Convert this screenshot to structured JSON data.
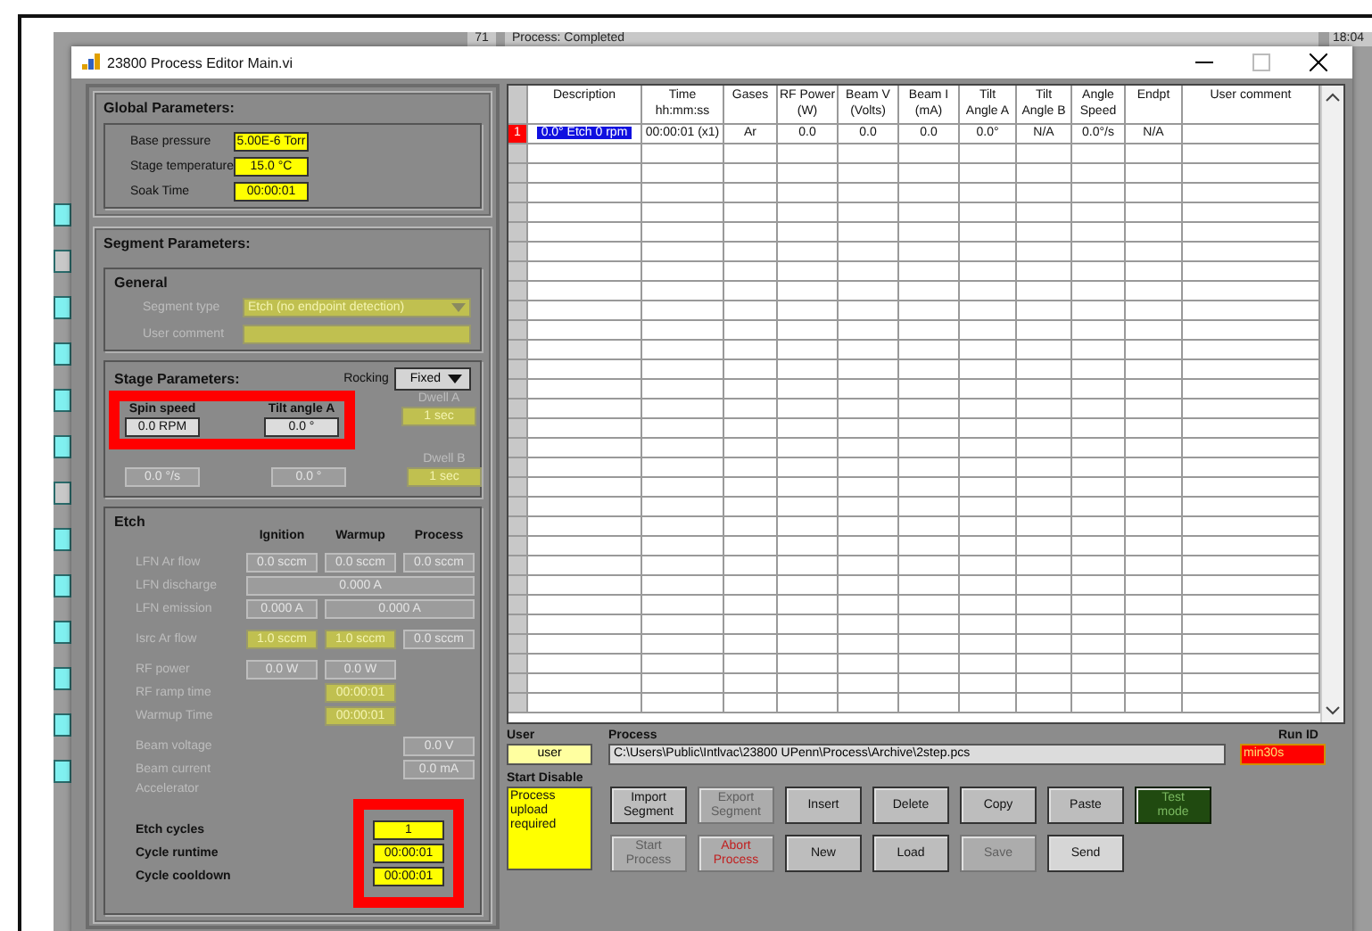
{
  "background_app": {
    "counter": "71",
    "status": "Process: Completed",
    "clock": "18:04"
  },
  "window": {
    "title": "23800 Process Editor Main.vi"
  },
  "global_parameters": {
    "title": "Global Parameters:",
    "fields": [
      {
        "label": "Base pressure",
        "value": "5.00E-6 Torr",
        "disabled": false,
        "highlighted": true
      },
      {
        "label": "Stage temperature",
        "value": "15.0 °C",
        "disabled": false,
        "highlighted": true
      },
      {
        "label": "Soak Time",
        "value": "00:00:01",
        "disabled": false,
        "highlighted": true
      }
    ]
  },
  "segment_parameters": {
    "title": "Segment Parameters:",
    "general": {
      "title": "General",
      "fields": [
        {
          "label": "Segment type",
          "kind": "dropdown",
          "value": "Etch (no endpoint detection)",
          "disabled": true,
          "highlighted": true
        },
        {
          "label": "User comment",
          "kind": "text",
          "disabled": true,
          "highlighted": true
        }
      ]
    },
    "stage": {
      "title": "Stage Parameters:",
      "rocking": {
        "label": "Rocking",
        "value": "Fixed"
      },
      "fields": [
        {
          "label": "Spin speed",
          "value": "0.0 RPM",
          "disabled": false,
          "highlighted": false
        },
        {
          "label": "Tilt angle A",
          "value": "0.0 °",
          "disabled": false,
          "highlighted": false
        },
        {
          "label": "Dwell A",
          "value": "1 sec",
          "disabled": true,
          "highlighted": true
        },
        {
          "value": "0.0 °/s",
          "disabled": true,
          "highlighted": false
        },
        {
          "value": "0.0 °",
          "disabled": true,
          "highlighted": false
        },
        {
          "label": "Dwell B",
          "value": "1 sec",
          "disabled": true,
          "highlighted": true
        }
      ]
    },
    "etch": {
      "title": "Etch",
      "columns": [
        "Ignition",
        "Warmup",
        "Process"
      ],
      "groups": [
        [
          {
            "label": "LFN Ar flow",
            "disabled": true,
            "cells": [
              {
                "kind": "single",
                "value": "0.0 sccm",
                "disabled": true,
                "highlighted": false
              },
              {
                "kind": "single",
                "value": "0.0 sccm",
                "disabled": true,
                "highlighted": false
              },
              {
                "kind": "single",
                "value": "0.0 sccm",
                "disabled": true,
                "highlighted": false
              }
            ]
          },
          {
            "label": "LFN discharge",
            "disabled": true,
            "cells": [
              {
                "kind": "wide",
                "value": "0.000 A",
                "disabled": true,
                "highlighted": false
              }
            ]
          },
          {
            "label": "LFN emission",
            "disabled": true,
            "cells": [
              {
                "kind": "single",
                "value": "0.000 A",
                "disabled": true,
                "highlighted": false
              },
              {
                "kind": "wide",
                "value": "0.000 A",
                "disabled": true,
                "highlighted": false
              }
            ]
          }
        ],
        [
          {
            "label": "Isrc Ar flow",
            "disabled": true,
            "cells": [
              {
                "kind": "single",
                "value": "1.0 sccm",
                "disabled": true,
                "highlighted": true
              },
              {
                "kind": "single",
                "value": "1.0 sccm",
                "disabled": true,
                "highlighted": true
              },
              {
                "kind": "single",
                "value": "0.0 sccm",
                "disabled": true,
                "highlighted": false
              }
            ]
          }
        ],
        [
          {
            "label": "RF power",
            "disabled": true,
            "cells": [
              {
                "kind": "single",
                "value": "0.0 W",
                "disabled": true,
                "highlighted": false
              },
              {
                "kind": "single",
                "value": "0.0 W",
                "disabled": true,
                "highlighted": false
              }
            ]
          },
          {
            "label": "RF ramp time",
            "disabled": true,
            "cells": [
              null,
              {
                "kind": "single",
                "value": "00:00:01",
                "disabled": true,
                "highlighted": true
              }
            ]
          },
          {
            "label": "Warmup Time",
            "disabled": true,
            "cells": [
              null,
              {
                "kind": "single",
                "value": "00:00:01",
                "disabled": true,
                "highlighted": true
              }
            ]
          }
        ],
        [
          {
            "label": "Beam voltage",
            "disabled": true,
            "cells": [
              null,
              null,
              {
                "kind": "single",
                "value": "0.0 V",
                "disabled": true,
                "highlighted": false
              }
            ]
          },
          {
            "label": "Beam current",
            "disabled": true,
            "cells": [
              null,
              null,
              {
                "kind": "single",
                "value": "0.0 mA",
                "disabled": true,
                "highlighted": false
              }
            ]
          },
          {
            "label": "Accelerator",
            "disabled": true
          }
        ]
      ],
      "cycles": [
        {
          "label": "Etch cycles",
          "value": "1",
          "disabled": false,
          "highlighted": true
        },
        {
          "label": "Cycle runtime",
          "value": "00:00:01",
          "disabled": false,
          "highlighted": true
        },
        {
          "label": "Cycle cooldown",
          "value": "00:00:01",
          "disabled": false,
          "highlighted": true
        }
      ]
    }
  },
  "table": {
    "columns": [
      "Description",
      "Time\nhh:mm:ss",
      "Gases",
      "RF Power\n(W)",
      "Beam V\n(Volts)",
      "Beam I\n(mA)",
      "Tilt\nAngle A",
      "Tilt\nAngle B",
      "Angle\nSpeed",
      "Endpt",
      "User comment"
    ],
    "rows": [
      {
        "number": "1",
        "selected": true,
        "cells": [
          "0.0° Etch 0 rpm",
          "00:00:01 (x1)",
          "Ar",
          "0.0",
          "0.0",
          "0.0",
          "0.0°",
          "N/A",
          "0.0°/s",
          "N/A"
        ]
      }
    ]
  },
  "user": {
    "label": "User",
    "value": "user"
  },
  "process": {
    "label": "Process",
    "path": "C:\\Users\\Public\\Intlvac\\23800 UPenn\\Process\\Archive\\2step.pcs"
  },
  "run_id": {
    "label": "Run ID",
    "value": "min30s"
  },
  "start_disable": {
    "label": "Start Disable",
    "message": "Process\nupload\nrequired"
  },
  "buttons": [
    [
      {
        "label": "Import\nSegment",
        "kind": "normal",
        "disabled": false,
        "focused": false
      },
      {
        "label": "Export\nSegment",
        "kind": "normal",
        "disabled": true,
        "focused": false
      },
      {
        "label": "Insert",
        "kind": "normal",
        "disabled": false,
        "focused": false
      },
      {
        "label": "Delete",
        "kind": "normal",
        "disabled": false,
        "focused": false
      },
      {
        "label": "Copy",
        "kind": "normal",
        "disabled": false,
        "focused": false
      },
      {
        "label": "Paste",
        "kind": "normal",
        "disabled": false,
        "focused": false
      },
      {
        "label": "Test\nmode",
        "kind": "toggle",
        "disabled": false,
        "focused": false
      }
    ],
    [
      {
        "label": "Start\nProcess",
        "kind": "normal",
        "disabled": true,
        "focused": false
      },
      {
        "label": "Abort\nProcess",
        "kind": "danger",
        "disabled": true,
        "focused": false
      },
      {
        "label": "New",
        "kind": "normal",
        "disabled": false,
        "focused": false
      },
      {
        "label": "Load",
        "kind": "normal",
        "disabled": false,
        "focused": false
      },
      {
        "label": "Save",
        "kind": "normal",
        "disabled": true,
        "focused": false
      },
      {
        "label": "Send",
        "kind": "normal",
        "disabled": false,
        "focused": true
      }
    ]
  ]
}
